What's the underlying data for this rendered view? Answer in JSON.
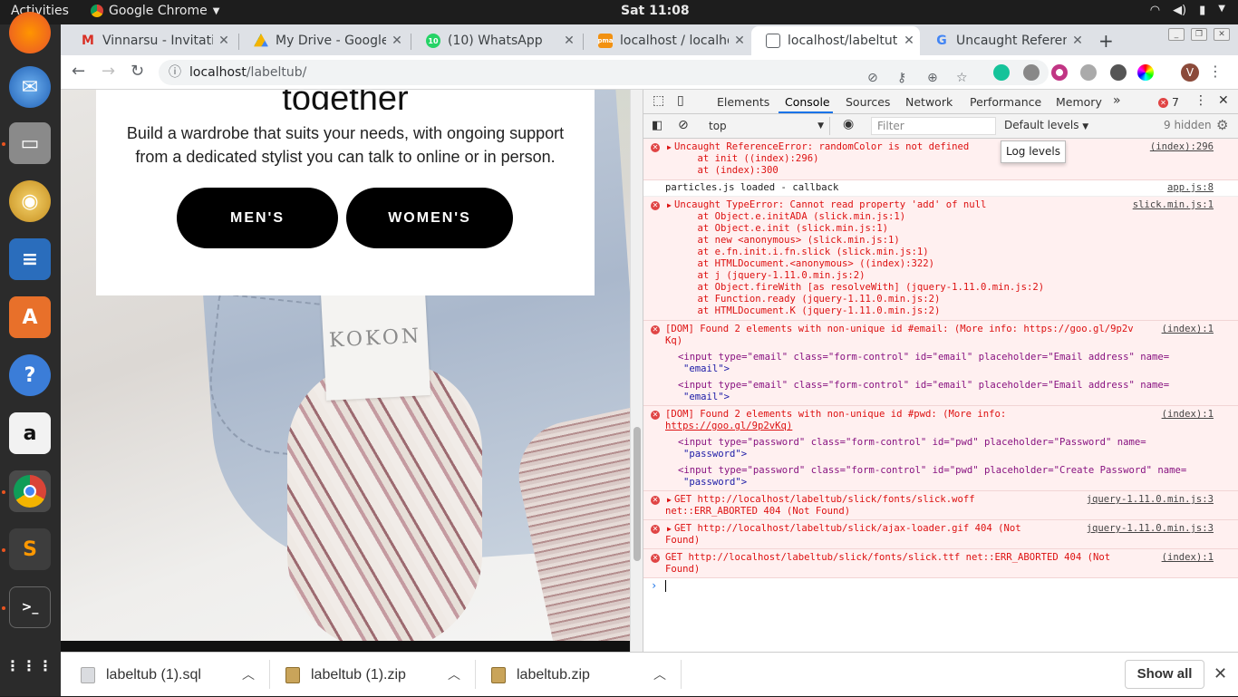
{
  "topbar": {
    "activities": "Activities",
    "app": "Google Chrome",
    "clock": "Sat 11:08"
  },
  "tabs": [
    {
      "title": "Vinnarsu - Invitati",
      "favicon": "gmail-icon",
      "color": "#d93025",
      "glyph": "M"
    },
    {
      "title": "My Drive - Google",
      "favicon": "google-drive-icon",
      "color": "#1a73e8",
      "glyph": "▲"
    },
    {
      "title": "(10) WhatsApp",
      "favicon": "whatsapp-icon",
      "color": "#25d366",
      "glyph": "10"
    },
    {
      "title": "localhost / localho",
      "favicon": "phpmyadmin-icon",
      "color": "#f29111",
      "glyph": "pma"
    },
    {
      "title": "localhost/labeltut",
      "favicon": "page-icon",
      "color": "#ffffff",
      "glyph": "▭"
    },
    {
      "title": "Uncaught Referen",
      "favicon": "google-icon",
      "color": "#4285f4",
      "glyph": "G"
    }
  ],
  "toolbar": {
    "url_host": "localhost",
    "url_path": "/labeltub/",
    "profile_initial": "V"
  },
  "page": {
    "heading": "together",
    "body": "Build a wardrobe that suits your needs, with ongoing support from a dedicated stylist you can talk to online or in person.",
    "mens_button": "MEN'S",
    "womens_button": "WOMEN'S",
    "label_text": "KOKON"
  },
  "devtools": {
    "tabs": [
      "Elements",
      "Console",
      "Sources",
      "Network",
      "Performance",
      "Memory"
    ],
    "error_count": "7",
    "context": "top",
    "filter_placeholder": "Filter",
    "levels": "Default levels",
    "hidden": "9 hidden",
    "tooltip": "Log levels"
  },
  "console": {
    "m1_lines": [
      "Uncaught ReferenceError: randomColor is not defined",
      "    at init ((index):296)",
      "    at (index):300"
    ],
    "m1_src": "(index):296",
    "m2_text": "particles.js loaded - callback",
    "m2_src": "app.js:8",
    "m3_lines": [
      "Uncaught TypeError: Cannot read property 'add' of null",
      "    at Object.e.initADA (slick.min.js:1)",
      "    at Object.e.init (slick.min.js:1)",
      "    at new <anonymous> (slick.min.js:1)",
      "    at e.fn.init.i.fn.slick (slick.min.js:1)",
      "    at HTMLDocument.<anonymous> ((index):322)",
      "    at j (jquery-1.11.0.min.js:2)",
      "    at Object.fireWith [as resolveWith] (jquery-1.11.0.min.js:2)",
      "    at Function.ready (jquery-1.11.0.min.js:2)",
      "    at HTMLDocument.K (jquery-1.11.0.min.js:2)"
    ],
    "m3_src": "slick.min.js:1",
    "m4_head": "[DOM] Found 2 elements with non-unique id #email: (More info: https://goo.gl/9p2v",
    "m4_head2": "Kq)",
    "m4_src": "(index):1",
    "m4_el1a": "<input type=\"email\" class=\"form-control\" id=\"email\" placeholder=\"Email address\" name=",
    "m4_el1b": "\"email\">",
    "m4_el2a": "<input type=\"email\" class=\"form-control\" id=\"email\" placeholder=\"Email address\" name=",
    "m4_el2b": "\"email\">",
    "m5_head": "[DOM] Found 2 elements with non-unique id #pwd: (More info:",
    "m5_head2": "https://goo.gl/9p2vKq)",
    "m5_src": "(index):1",
    "m5_el1a": "<input type=\"password\" class=\"form-control\" id=\"pwd\" placeholder=\"Password\" name=",
    "m5_el1b": "\"password\">",
    "m5_el2a": "<input type=\"password\" class=\"form-control\" id=\"pwd\" placeholder=\"Create Password\" name=",
    "m5_el2b": "\"password\">",
    "m6_a": "GET http://localhost/labeltub/slick/fonts/slick.woff",
    "m6_b": "net::ERR_ABORTED 404 (Not Found)",
    "m6_src": "jquery-1.11.0.min.js:3",
    "m7_a": "GET http://localhost/labeltub/slick/ajax-loader.gif 404 (Not",
    "m7_b": "Found)",
    "m7_src": "jquery-1.11.0.min.js:3",
    "m8_a": "GET http://localhost/labeltub/slick/fonts/slick.ttf net::ERR_ABORTED 404 (Not",
    "m8_b": "Found)",
    "m8_src": "(index):1"
  },
  "downloads": [
    {
      "name": "labeltub (1).sql"
    },
    {
      "name": "labeltub (1).zip"
    },
    {
      "name": "labeltub.zip"
    }
  ],
  "downloads_show_all": "Show all"
}
